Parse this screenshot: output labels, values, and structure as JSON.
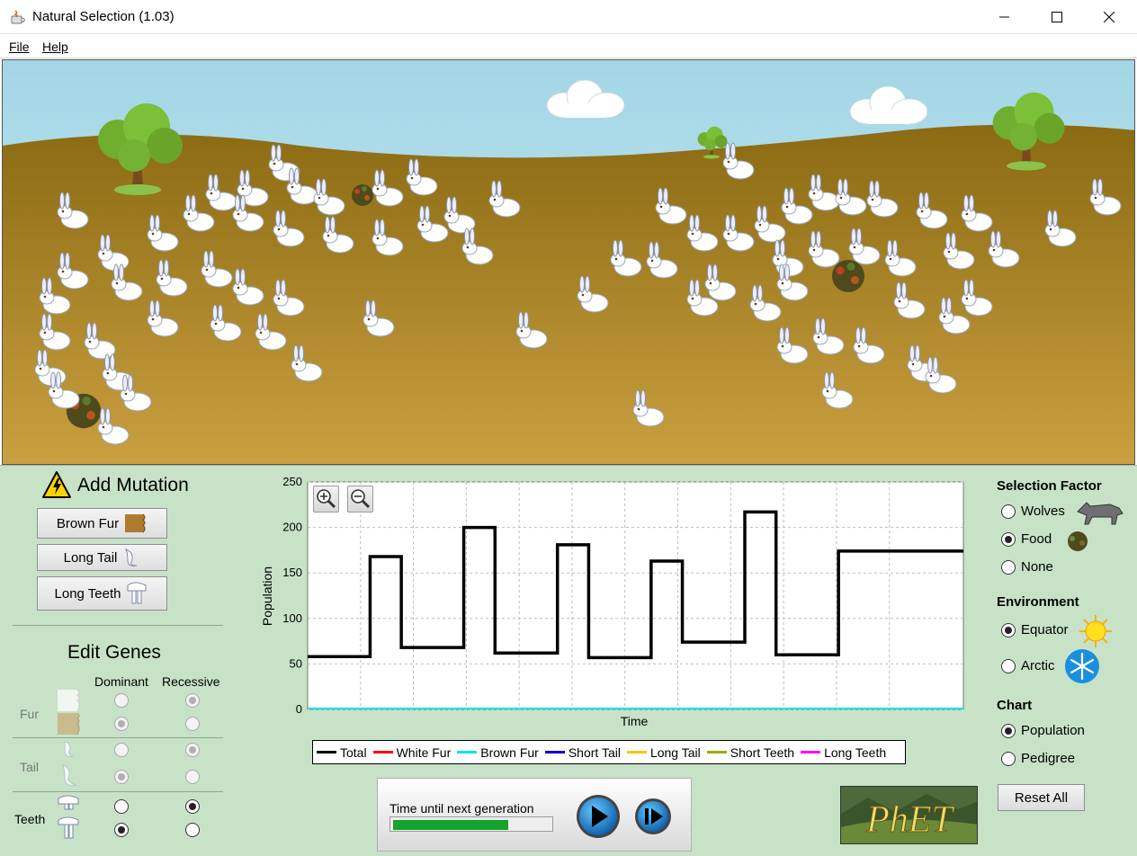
{
  "window": {
    "title": "Natural Selection (1.03)",
    "controls": [
      "minimize-icon",
      "maximize-icon",
      "close-icon"
    ]
  },
  "menu": {
    "file": "File",
    "help": "Help"
  },
  "mutation": {
    "title": "Add Mutation",
    "buttons": [
      "Brown Fur",
      "Long Tail",
      "Long Teeth"
    ]
  },
  "genes": {
    "title": "Edit Genes",
    "col_dominant": "Dominant",
    "col_recessive": "Recessive",
    "rows": [
      {
        "label": "Fur",
        "enabled": false,
        "dominant": "none",
        "recessive": "top"
      },
      {
        "label": "Tail",
        "enabled": false,
        "dominant": "none",
        "recessive": "top"
      },
      {
        "label": "Teeth",
        "enabled": true,
        "dominant": "bottom",
        "recessive": "top"
      }
    ]
  },
  "chart_data": {
    "type": "line",
    "xlabel": "Time",
    "ylabel": "Population",
    "ylim": [
      0,
      250
    ],
    "yticks": [
      "0",
      "50",
      "100",
      "150",
      "200",
      "250"
    ],
    "grid": true,
    "legend_position": "bottom",
    "x": [
      0,
      1,
      2,
      3,
      4,
      5,
      6,
      7,
      8,
      9,
      10,
      11,
      12,
      13,
      14,
      15,
      16,
      17,
      18,
      19,
      20,
      21
    ],
    "series": [
      {
        "name": "Total",
        "color": "#000000",
        "values": [
          58,
          58,
          168,
          68,
          68,
          200,
          62,
          62,
          181,
          57,
          57,
          163,
          74,
          74,
          217,
          60,
          60,
          174,
          174,
          174,
          174,
          174
        ]
      },
      {
        "name": "White Fur",
        "color": "#ff0000",
        "values": []
      },
      {
        "name": "Brown Fur",
        "color": "#00e5e5",
        "values": []
      },
      {
        "name": "Short Tail",
        "color": "#0000cc",
        "values": []
      },
      {
        "name": "Long Tail",
        "color": "#ffc000",
        "values": []
      },
      {
        "name": "Short Teeth",
        "color": "#a6a600",
        "values": []
      },
      {
        "name": "Long Teeth",
        "color": "#ff00ff",
        "values": []
      }
    ]
  },
  "playback": {
    "label": "Time until next generation",
    "progress": 0.73
  },
  "selection": {
    "title": "Selection Factor",
    "options": [
      "Wolves",
      "Food",
      "None"
    ],
    "selected": "Food"
  },
  "environment": {
    "title": "Environment",
    "options": [
      "Equator",
      "Arctic"
    ],
    "selected": "Equator"
  },
  "chart_choice": {
    "title": "Chart",
    "options": [
      "Population",
      "Pedigree"
    ],
    "selected": "Population"
  },
  "reset_label": "Reset All",
  "logo_text": "PhET"
}
